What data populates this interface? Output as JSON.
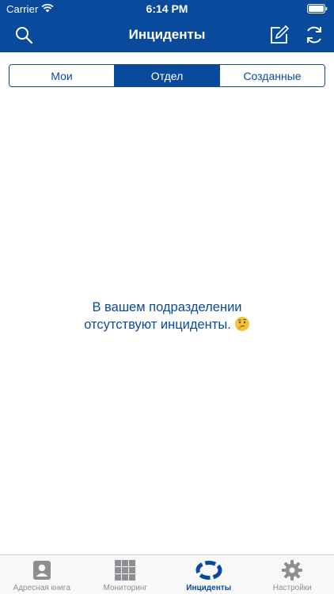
{
  "status_bar": {
    "carrier": "Carrier",
    "time": "6:14 PM"
  },
  "nav": {
    "title": "Инциденты",
    "icons": [
      "search-icon",
      "compose-icon",
      "refresh-icon"
    ]
  },
  "segments": [
    {
      "label": "Мои",
      "selected": false
    },
    {
      "label": "Отдел",
      "selected": true
    },
    {
      "label": "Созданные",
      "selected": false
    }
  ],
  "empty_state": {
    "line1": "В вашем подразделении",
    "line2": "отсутствуют инциденты.",
    "emoji": "thinking-face-icon"
  },
  "tabbar": {
    "items": [
      {
        "label": "Адресная книга",
        "icon": "address-book-icon",
        "active": false
      },
      {
        "label": "Мониторинг",
        "icon": "monitoring-grid-icon",
        "active": false
      },
      {
        "label": "Инциденты",
        "icon": "lifebuoy-icon",
        "active": true
      },
      {
        "label": "Настройки",
        "icon": "gear-icon",
        "active": false
      }
    ]
  },
  "colors": {
    "brand": "#0a4a9c",
    "tab_inactive": "#8e8e93",
    "tabbar_bg": "#f8f8f8"
  }
}
